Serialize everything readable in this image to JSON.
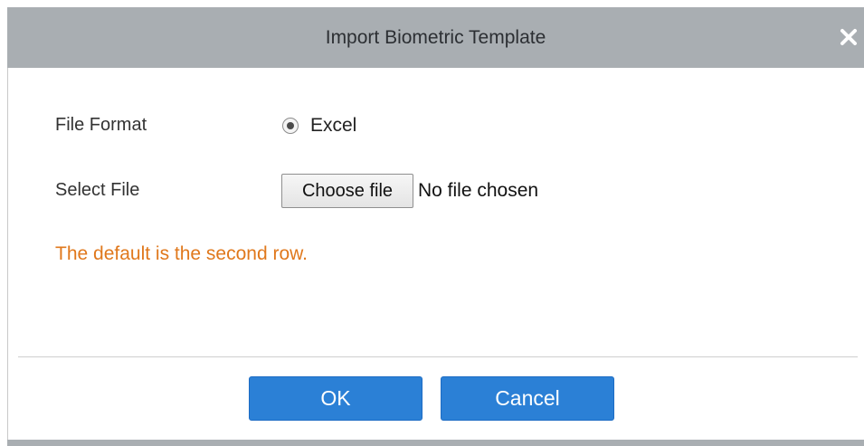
{
  "dialog": {
    "title": "Import Biometric Template",
    "close_icon": "close-icon"
  },
  "form": {
    "file_format_label": "File Format",
    "file_format_option": "Excel",
    "file_format_selected": true,
    "select_file_label": "Select File",
    "choose_file_button": "Choose file",
    "file_status": "No file chosen",
    "hint": "The default is the second row."
  },
  "footer": {
    "ok_label": "OK",
    "cancel_label": "Cancel"
  },
  "colors": {
    "title_bar": "#a9aeb2",
    "hint_text": "#e0781c",
    "primary_button": "#2b80d6"
  }
}
